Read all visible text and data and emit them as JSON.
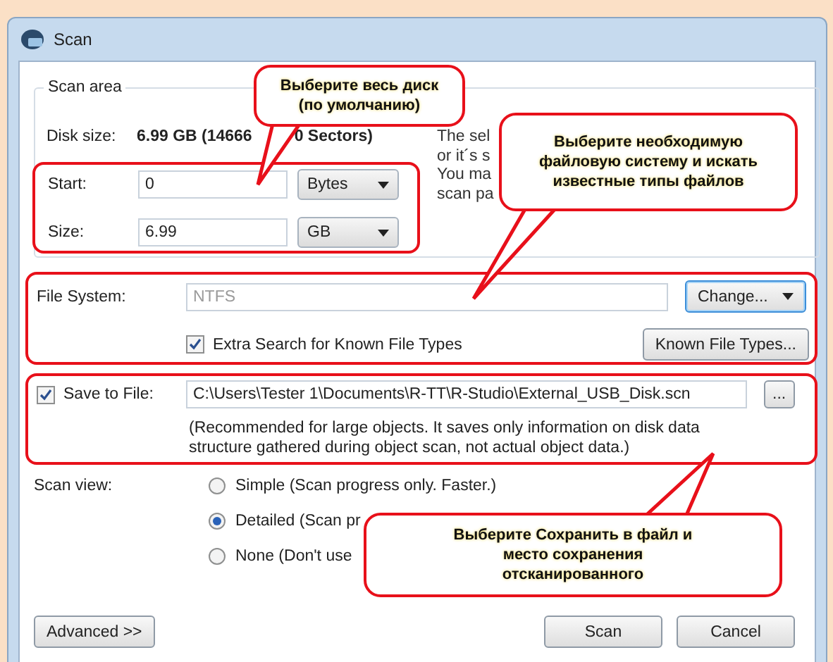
{
  "window": {
    "title": "Scan"
  },
  "scan_area": {
    "title": "Scan area",
    "disk_size_label": "Disk size:",
    "disk_size_value_start": "6.99 GB (14666",
    "disk_size_value_end": "0 Sectors)",
    "note_fragments": [
      "The sel",
      "or it´s s",
      "You ma",
      "scan pa"
    ],
    "start": {
      "label": "Start:",
      "value": "0",
      "unit": "Bytes"
    },
    "size": {
      "label": "Size:",
      "value": "6.99",
      "unit": "GB"
    }
  },
  "file_system": {
    "label": "File System:",
    "value": "NTFS",
    "disabled": true,
    "change_button": "Change...",
    "extra_search": {
      "label": "Extra Search for Known File Types",
      "checked": true
    },
    "known_types_button": "Known File Types..."
  },
  "save_to_file": {
    "label": "Save to File:",
    "checked": true,
    "path": "C:\\Users\\Tester 1\\Documents\\R-TT\\R-Studio\\External_USB_Disk.scn",
    "browse_button": "...",
    "note": "(Recommended for large objects. It saves only information on disk data structure gathered during object scan, not actual object data.)"
  },
  "scan_view": {
    "label": "Scan view:",
    "options": [
      {
        "label": "Simple (Scan progress only. Faster.)",
        "selected": false
      },
      {
        "label": "Detailed (Scan pr",
        "selected": true
      },
      {
        "label": "None (Don't use",
        "selected": false
      }
    ]
  },
  "buttons": [
    {
      "label": "Advanced >>"
    },
    {
      "label": "Scan"
    },
    {
      "label": "Cancel"
    }
  ],
  "callouts": [
    {
      "text": "Выберите весь диск (по умолчанию)"
    },
    {
      "text": "Выберите необходимую файловую систему и искать известные типы файлов"
    },
    {
      "text": "Выберите Сохранить в файл и место сохранения отсканированного"
    }
  ]
}
